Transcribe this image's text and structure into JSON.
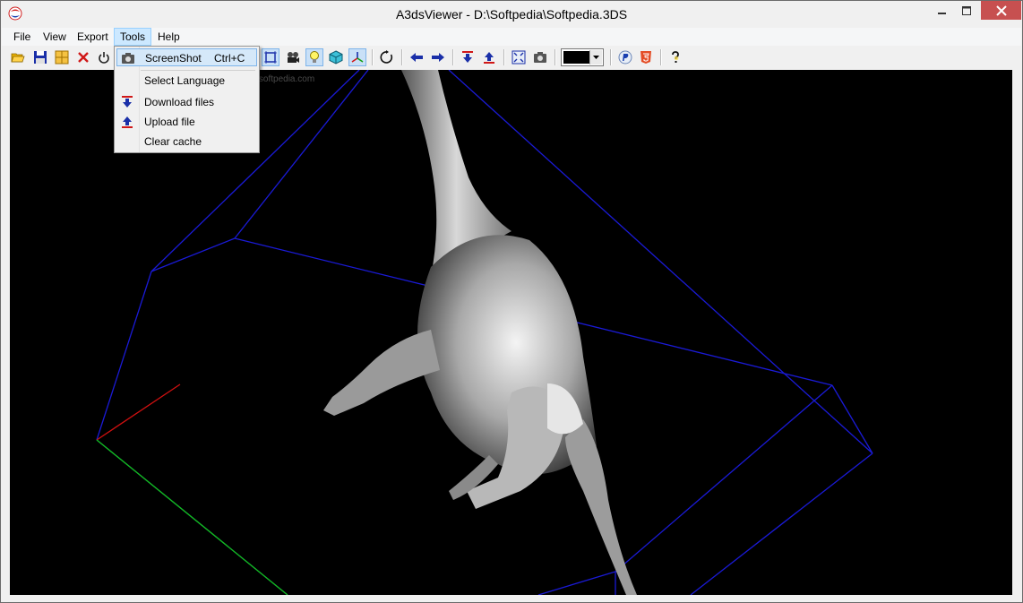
{
  "window": {
    "title": "A3dsViewer - D:\\Softpedia\\Softpedia.3DS"
  },
  "menu": [
    {
      "label": "File"
    },
    {
      "label": "View"
    },
    {
      "label": "Export"
    },
    {
      "label": "Tools"
    },
    {
      "label": "Help"
    }
  ],
  "tools_menu": {
    "screenshot": {
      "label": "ScreenShot",
      "shortcut": "Ctrl+C"
    },
    "select_language": {
      "label": "Select Language"
    },
    "download_files": {
      "label": "Download files"
    },
    "upload_file": {
      "label": "Upload file"
    },
    "clear_cache": {
      "label": "Clear cache"
    }
  },
  "watermark": "www.softpedia.com",
  "colors": {
    "background": "#000000",
    "bounding_box": "#1a1ad6",
    "axis_x": "#d01010",
    "axis_y": "#12c012",
    "model": "#cfcfcf"
  }
}
